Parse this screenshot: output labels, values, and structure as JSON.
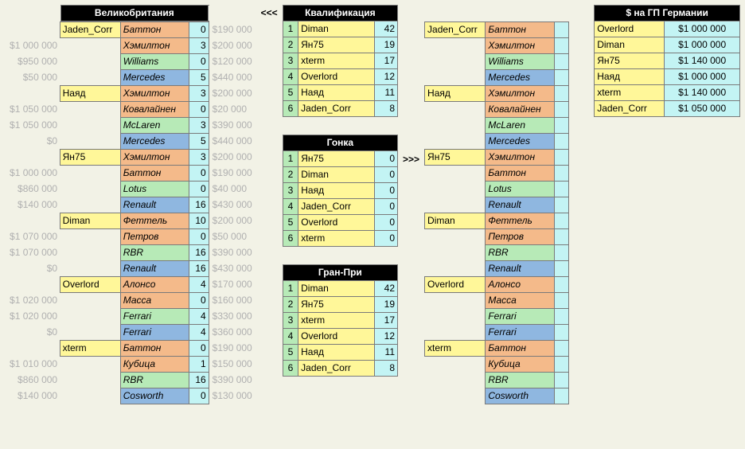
{
  "left_header": "Великобритания",
  "qual_header": "Квалификация",
  "race_header": "Гонка",
  "gp_header": "Гран-При",
  "money_header": "$ на ГП Германии",
  "left_groups": [
    {
      "player": "Jaden_Corr",
      "rows": [
        {
          "ml": "",
          "name": "Баттон",
          "pts": 0,
          "mr": "$190 000",
          "c": "peach"
        },
        {
          "ml": "$1 000 000",
          "name": "Хэмилтон",
          "pts": 3,
          "mr": "$200 000",
          "c": "peach"
        },
        {
          "ml": "$950 000",
          "name": "Williams",
          "pts": 0,
          "mr": "$120 000",
          "c": "green"
        },
        {
          "ml": "$50 000",
          "name": "Mercedes",
          "pts": 5,
          "mr": "$440 000",
          "c": "blue"
        }
      ]
    },
    {
      "player": "Наяд",
      "rows": [
        {
          "ml": "",
          "name": "Хэмилтон",
          "pts": 3,
          "mr": "$200 000",
          "c": "peach"
        },
        {
          "ml": "$1 050 000",
          "name": "Ковалайнен",
          "pts": 0,
          "mr": "$20 000",
          "c": "peach"
        },
        {
          "ml": "$1 050 000",
          "name": "McLaren",
          "pts": 3,
          "mr": "$390 000",
          "c": "green"
        },
        {
          "ml": "$0",
          "name": "Mercedes",
          "pts": 5,
          "mr": "$440 000",
          "c": "blue"
        }
      ]
    },
    {
      "player": "Ян75",
      "rows": [
        {
          "ml": "",
          "name": "Хэмилтон",
          "pts": 3,
          "mr": "$200 000",
          "c": "peach"
        },
        {
          "ml": "$1 000 000",
          "name": "Баттон",
          "pts": 0,
          "mr": "$190 000",
          "c": "peach"
        },
        {
          "ml": "$860 000",
          "name": "Lotus",
          "pts": 0,
          "mr": "$40 000",
          "c": "green"
        },
        {
          "ml": "$140 000",
          "name": "Renault",
          "pts": 16,
          "mr": "$430 000",
          "c": "blue"
        }
      ]
    },
    {
      "player": "Diman",
      "rows": [
        {
          "ml": "",
          "name": "Феттель",
          "pts": 10,
          "mr": "$200 000",
          "c": "peach"
        },
        {
          "ml": "$1 070 000",
          "name": "Петров",
          "pts": 0,
          "mr": "$50 000",
          "c": "peach"
        },
        {
          "ml": "$1 070 000",
          "name": "RBR",
          "pts": 16,
          "mr": "$390 000",
          "c": "green"
        },
        {
          "ml": "$0",
          "name": "Renault",
          "pts": 16,
          "mr": "$430 000",
          "c": "blue"
        }
      ]
    },
    {
      "player": "Overlord",
      "rows": [
        {
          "ml": "",
          "name": "Алонсо",
          "pts": 4,
          "mr": "$170 000",
          "c": "peach"
        },
        {
          "ml": "$1 020 000",
          "name": "Масса",
          "pts": 0,
          "mr": "$160 000",
          "c": "peach"
        },
        {
          "ml": "$1 020 000",
          "name": "Ferrari",
          "pts": 4,
          "mr": "$330 000",
          "c": "green"
        },
        {
          "ml": "$0",
          "name": "Ferrari",
          "pts": 4,
          "mr": "$360 000",
          "c": "blue"
        }
      ]
    },
    {
      "player": "xterm",
      "rows": [
        {
          "ml": "",
          "name": "Баттон",
          "pts": 0,
          "mr": "$190 000",
          "c": "peach"
        },
        {
          "ml": "$1 010 000",
          "name": "Кубица",
          "pts": 1,
          "mr": "$150 000",
          "c": "peach"
        },
        {
          "ml": "$860 000",
          "name": "RBR",
          "pts": 16,
          "mr": "$390 000",
          "c": "green"
        },
        {
          "ml": "$140 000",
          "name": "Cosworth",
          "pts": 0,
          "mr": "$130 000",
          "c": "blue"
        }
      ]
    }
  ],
  "qual": [
    {
      "n": 1,
      "name": "Diman",
      "pts": 42
    },
    {
      "n": 2,
      "name": "Ян75",
      "pts": 19
    },
    {
      "n": 3,
      "name": "xterm",
      "pts": 17
    },
    {
      "n": 4,
      "name": "Overlord",
      "pts": 12
    },
    {
      "n": 5,
      "name": "Наяд",
      "pts": 11
    },
    {
      "n": 6,
      "name": "Jaden_Corr",
      "pts": 8
    }
  ],
  "race": [
    {
      "n": 1,
      "name": "Ян75",
      "pts": 0
    },
    {
      "n": 2,
      "name": "Diman",
      "pts": 0
    },
    {
      "n": 3,
      "name": "Наяд",
      "pts": 0
    },
    {
      "n": 4,
      "name": "Jaden_Corr",
      "pts": 0
    },
    {
      "n": 5,
      "name": "Overlord",
      "pts": 0
    },
    {
      "n": 6,
      "name": "xterm",
      "pts": 0
    }
  ],
  "gp": [
    {
      "n": 1,
      "name": "Diman",
      "pts": 42
    },
    {
      "n": 2,
      "name": "Ян75",
      "pts": 19
    },
    {
      "n": 3,
      "name": "xterm",
      "pts": 17
    },
    {
      "n": 4,
      "name": "Overlord",
      "pts": 12
    },
    {
      "n": 5,
      "name": "Наяд",
      "pts": 11
    },
    {
      "n": 6,
      "name": "Jaden_Corr",
      "pts": 8
    }
  ],
  "right_groups": [
    {
      "player": "Jaden_Corr",
      "rows": [
        {
          "name": "Баттон",
          "c": "peach"
        },
        {
          "name": "Хэмилтон",
          "c": "peach"
        },
        {
          "name": "Williams",
          "c": "green"
        },
        {
          "name": "Mercedes",
          "c": "blue"
        }
      ]
    },
    {
      "player": "Наяд",
      "rows": [
        {
          "name": "Хэмилтон",
          "c": "peach"
        },
        {
          "name": "Ковалайнен",
          "c": "peach"
        },
        {
          "name": "McLaren",
          "c": "green"
        },
        {
          "name": "Mercedes",
          "c": "blue"
        }
      ]
    },
    {
      "player": "Ян75",
      "rows": [
        {
          "name": "Хэмилтон",
          "c": "peach"
        },
        {
          "name": "Баттон",
          "c": "peach"
        },
        {
          "name": "Lotus",
          "c": "green"
        },
        {
          "name": "Renault",
          "c": "blue"
        }
      ]
    },
    {
      "player": "Diman",
      "rows": [
        {
          "name": "Феттель",
          "c": "peach"
        },
        {
          "name": "Петров",
          "c": "peach"
        },
        {
          "name": "RBR",
          "c": "green"
        },
        {
          "name": "Renault",
          "c": "blue"
        }
      ]
    },
    {
      "player": "Overlord",
      "rows": [
        {
          "name": "Алонсо",
          "c": "peach"
        },
        {
          "name": "Масса",
          "c": "peach"
        },
        {
          "name": "Ferrari",
          "c": "green"
        },
        {
          "name": "Ferrari",
          "c": "blue"
        }
      ]
    },
    {
      "player": "xterm",
      "rows": [
        {
          "name": "Баттон",
          "c": "peach"
        },
        {
          "name": "Кубица",
          "c": "peach"
        },
        {
          "name": "RBR",
          "c": "green"
        },
        {
          "name": "Cosworth",
          "c": "blue"
        }
      ]
    }
  ],
  "money": [
    {
      "name": "Overlord",
      "amt": "$1 000 000"
    },
    {
      "name": "Diman",
      "amt": "$1 000 000"
    },
    {
      "name": "Ян75",
      "amt": "$1 140 000"
    },
    {
      "name": "Наяд",
      "amt": "$1 000 000"
    },
    {
      "name": "xterm",
      "amt": "$1 140 000"
    },
    {
      "name": "Jaden_Corr",
      "amt": "$1 050 000"
    }
  ],
  "chart_data": {
    "type": "table",
    "title": "F1 fantasy standings — UK GP results & budgets for German GP",
    "series": [
      {
        "name": "Квалификация",
        "categories": [
          "Diman",
          "Ян75",
          "xterm",
          "Overlord",
          "Наяд",
          "Jaden_Corr"
        ],
        "values": [
          42,
          19,
          17,
          12,
          11,
          8
        ]
      },
      {
        "name": "Гонка",
        "categories": [
          "Ян75",
          "Diman",
          "Наяд",
          "Jaden_Corr",
          "Overlord",
          "xterm"
        ],
        "values": [
          0,
          0,
          0,
          0,
          0,
          0
        ]
      },
      {
        "name": "Гран-При",
        "categories": [
          "Diman",
          "Ян75",
          "xterm",
          "Overlord",
          "Наяд",
          "Jaden_Corr"
        ],
        "values": [
          42,
          19,
          17,
          12,
          11,
          8
        ]
      },
      {
        "name": "$ на ГП Германии",
        "categories": [
          "Overlord",
          "Diman",
          "Ян75",
          "Наяд",
          "xterm",
          "Jaden_Corr"
        ],
        "values": [
          1000000,
          1000000,
          1140000,
          1000000,
          1140000,
          1050000
        ]
      }
    ]
  }
}
